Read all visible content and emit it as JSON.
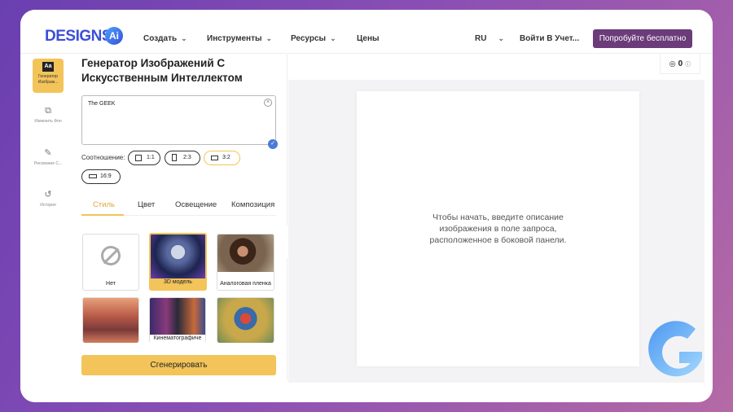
{
  "brand": {
    "logo_text": "DESIGNS.",
    "logo_badge": "Ai"
  },
  "nav": [
    {
      "label": "Создать",
      "has_chevron": true
    },
    {
      "label": "Инструменты",
      "has_chevron": true
    },
    {
      "label": "Ресурсы",
      "has_chevron": true
    },
    {
      "label": "Цены",
      "has_chevron": false
    }
  ],
  "header_right": {
    "language": "RU",
    "login": "Войти В Учет...",
    "cta": "Попробуйте бесплатно"
  },
  "rail": [
    {
      "label": "Генератор Изображ...",
      "icon": "text-box-icon",
      "glyph": "Aa",
      "active": true
    },
    {
      "label": "Изменить Фон",
      "icon": "layers-icon",
      "glyph": "⧉",
      "active": false
    },
    {
      "label": "Рисование С...",
      "icon": "pen-icon",
      "glyph": "✎",
      "active": false
    },
    {
      "label": "История",
      "icon": "history-icon",
      "glyph": "↺",
      "active": false
    }
  ],
  "panel": {
    "title": "Генератор Изображений С Искусственным Интеллектом",
    "prompt_value": "The GEEK",
    "ratio_label": "Соотношение:",
    "ratios": [
      {
        "label": "1:1",
        "selected": false
      },
      {
        "label": "2:3",
        "selected": false
      },
      {
        "label": "3:2",
        "selected": true
      },
      {
        "label": "16:9",
        "selected": false
      }
    ],
    "tabs": [
      {
        "label": "Стиль",
        "active": true
      },
      {
        "label": "Цвет",
        "active": false
      },
      {
        "label": "Освещение",
        "active": false
      },
      {
        "label": "Композиция",
        "active": false
      }
    ],
    "styles": [
      {
        "label": "Нет",
        "selected": false
      },
      {
        "label": "3D модель",
        "selected": true
      },
      {
        "label": "Аналоговая пленка",
        "selected": false
      },
      {
        "label": "",
        "selected": false
      },
      {
        "label": "Кинематографиче",
        "selected": false
      },
      {
        "label": "",
        "selected": false
      }
    ],
    "generate": "Сгенерировать"
  },
  "credits": {
    "value": "0"
  },
  "canvas": {
    "hint": "Чтобы начать, введите описание изображения в поле запроса, расположенное в боковой панели."
  },
  "colors": {
    "accent": "#f2c45a",
    "cta": "#6b3b7a",
    "brand": "#3b4fd8"
  }
}
